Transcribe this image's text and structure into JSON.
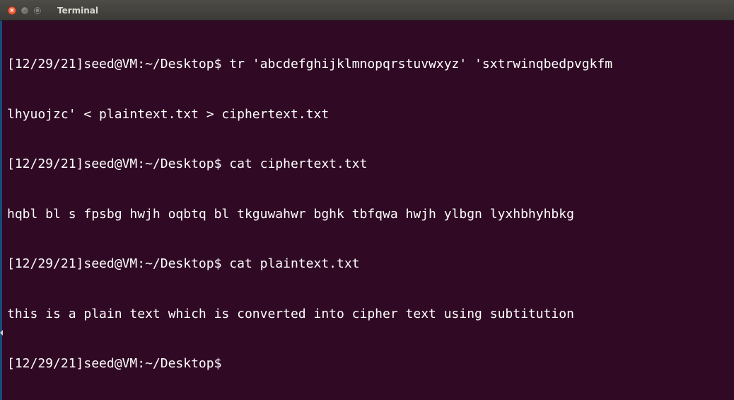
{
  "window": {
    "title": "Terminal",
    "icons": {
      "close": "close-icon",
      "minimize": "minimize-icon",
      "maximize": "maximize-icon"
    }
  },
  "terminal": {
    "background": "#300a24",
    "foreground": "#ffffff",
    "lines": [
      "[12/29/21]seed@VM:~/Desktop$ tr 'abcdefghijklmnopqrstuvwxyz' 'sxtrwinqbedpvgkfm",
      "lhyuojzc' < plaintext.txt > ciphertext.txt",
      "[12/29/21]seed@VM:~/Desktop$ cat ciphertext.txt",
      "hqbl bl s fpsbg hwjh oqbtq bl tkguwahwr bghk tbfqwa hwjh ylbgn lyxhbhyhbkg",
      "[12/29/21]seed@VM:~/Desktop$ cat plaintext.txt",
      "this is a plain text which is converted into cipher text using subtitution",
      "[12/29/21]seed@VM:~/Desktop$"
    ]
  }
}
